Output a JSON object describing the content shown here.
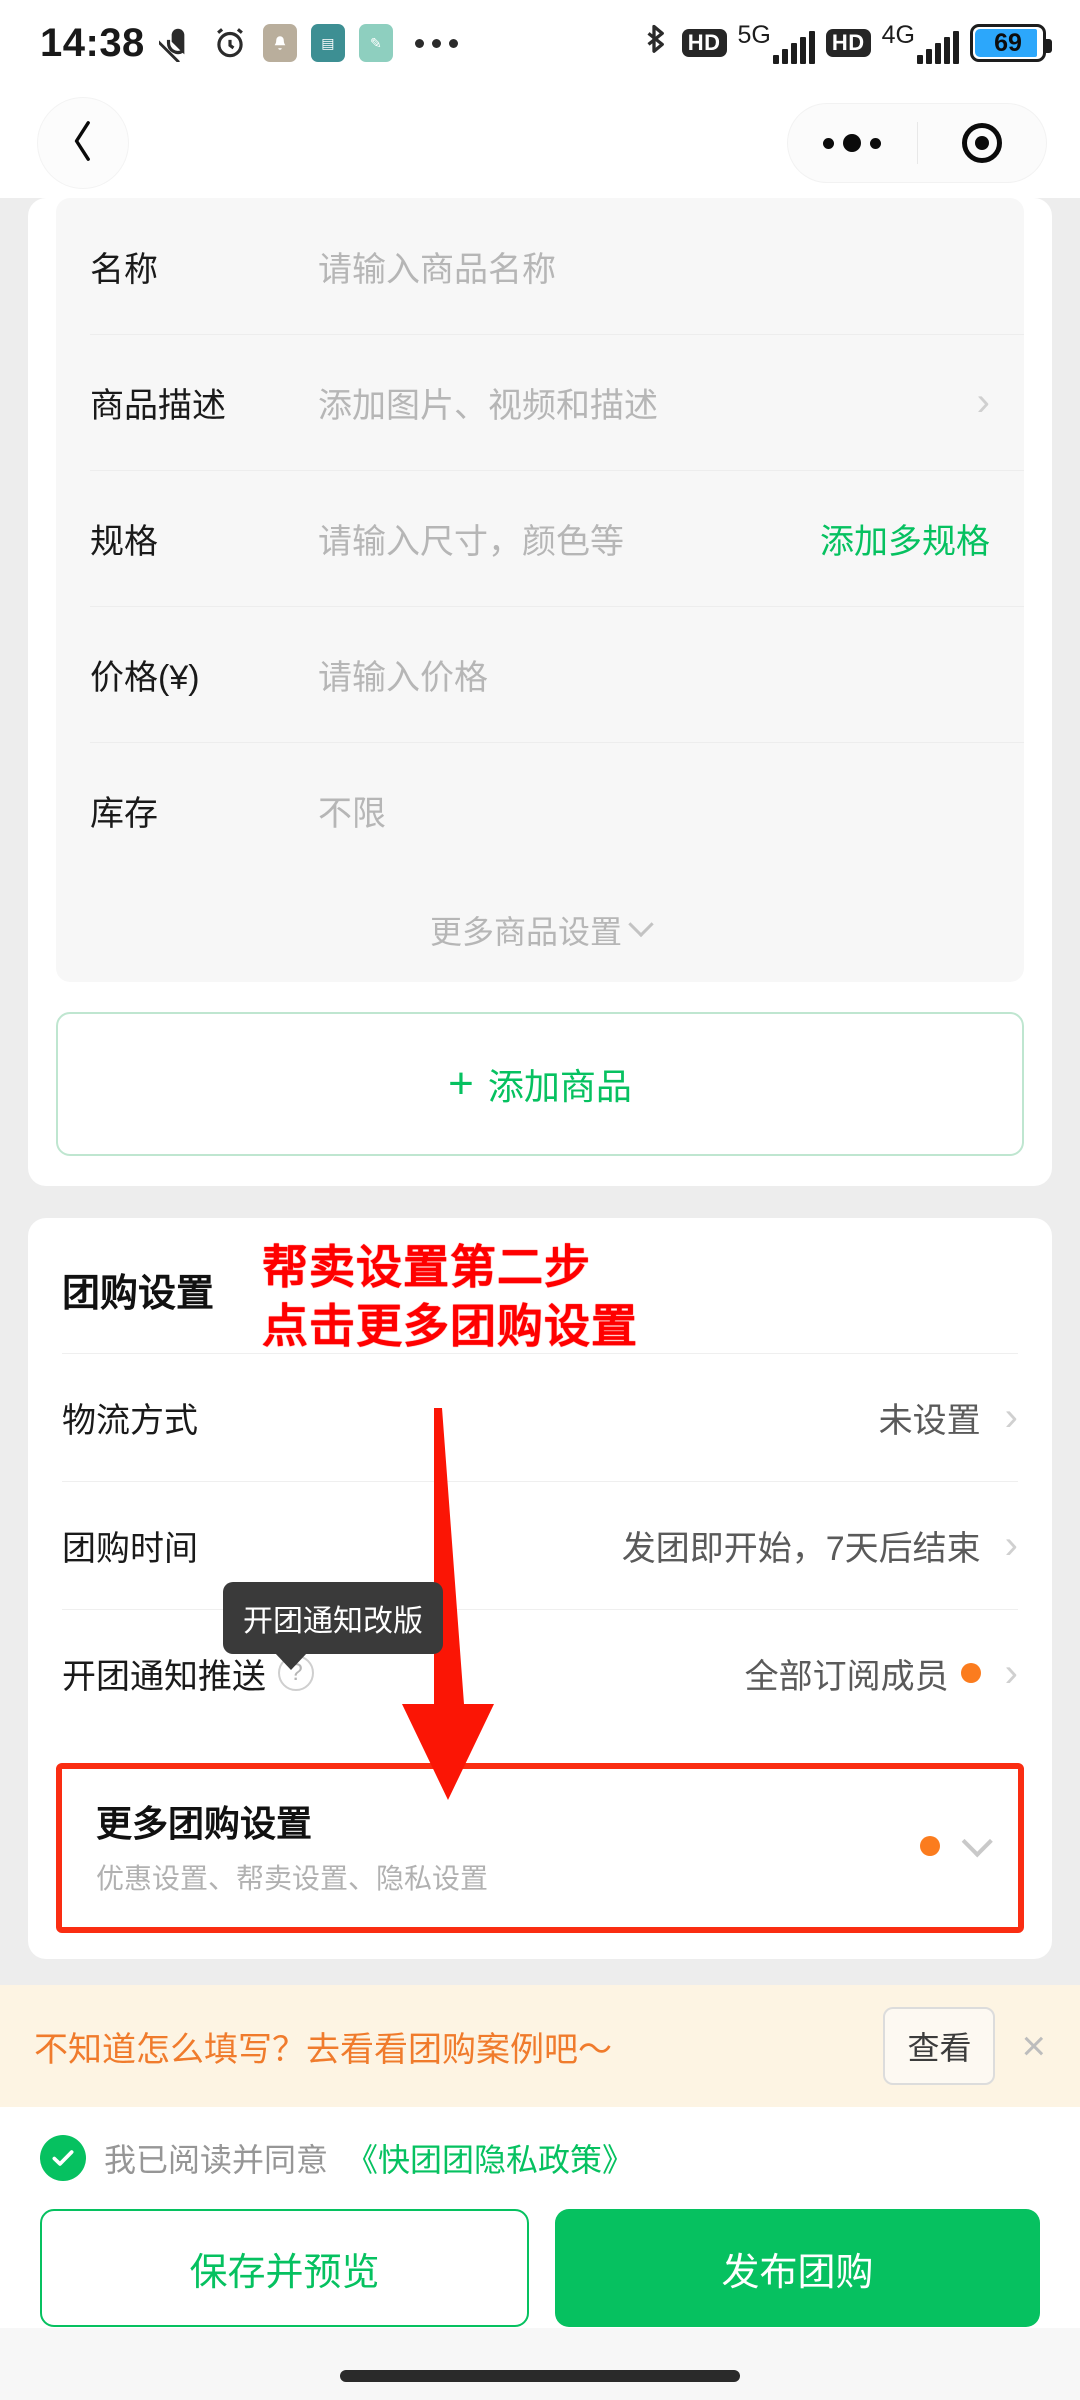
{
  "status_bar": {
    "time": "14:38",
    "icons_left": [
      "mute-icon",
      "alarm-icon",
      "notification-app-icon",
      "app-icon-teal",
      "app-icon-mint",
      "overflow-dots-icon"
    ],
    "bluetooth": "bluetooth-icon",
    "hd1": "HD",
    "net1": "5G",
    "hd2": "HD",
    "net2": "4G",
    "battery_percent": "69"
  },
  "nav": {
    "back": "back-icon",
    "capsule_more": "more-dots-icon",
    "capsule_target": "target-icon"
  },
  "product_form": {
    "rows": [
      {
        "label": "名称",
        "value": "请输入商品名称",
        "action": "",
        "chevron": false
      },
      {
        "label": "商品描述",
        "value": "添加图片、视频和描述",
        "action": "",
        "chevron": true
      },
      {
        "label": "规格",
        "value": "请输入尺寸，颜色等",
        "action": "添加多规格",
        "chevron": false
      },
      {
        "label": "价格(¥)",
        "value": "请输入价格",
        "action": "",
        "chevron": false
      },
      {
        "label": "库存",
        "value": "不限",
        "action": "",
        "chevron": false
      }
    ],
    "more_label": "更多商品设置",
    "add_product": "添加商品",
    "add_plus": "+"
  },
  "group_settings": {
    "title": "团购设置",
    "rows": [
      {
        "label": "物流方式",
        "value": "未设置",
        "help": false,
        "dot": false
      },
      {
        "label": "团购时间",
        "value": "发团即开始，7天后结束",
        "help": false,
        "dot": false
      },
      {
        "label": "开团通知推送",
        "value": "全部订阅成员",
        "help": true,
        "dot": true
      }
    ],
    "tooltip": "开团通知改版",
    "more": {
      "title": "更多团购设置",
      "subtitle": "优惠设置、帮卖设置、隐私设置"
    }
  },
  "annotation": {
    "line1": "帮卖设置第二步",
    "line2": "点击更多团购设置",
    "color": "#ff0000"
  },
  "banner": {
    "text": "不知道怎么填写？去看看团购案例吧～",
    "button": "查看",
    "close": "×"
  },
  "bottom": {
    "agree_prefix": "我已阅读并同意",
    "agree_link": "《快团团隐私政策》",
    "save_preview": "保存并预览",
    "publish": "发布团购"
  },
  "colors": {
    "brand_green": "#06c160",
    "accent_orange": "#fb7c1e",
    "annotation_red": "#ff0000",
    "banner_bg": "#fdf4e3",
    "banner_text": "#f07b2c"
  }
}
